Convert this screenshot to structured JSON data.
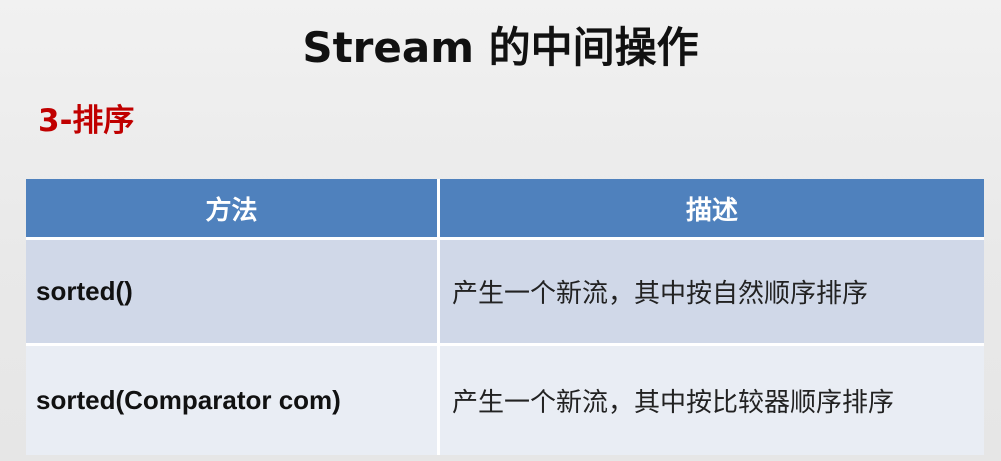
{
  "slide": {
    "title": "Stream 的中间操作",
    "subtitle": "3-排序"
  },
  "table": {
    "headers": [
      "方法",
      "描述"
    ],
    "rows": [
      [
        "sorted()",
        "产生一个新流，其中按自然顺序排序"
      ],
      [
        "sorted(Comparator com)",
        "产生一个新流，其中按比较器顺序排序"
      ]
    ]
  },
  "colors": {
    "header_bg": "#4f81bd",
    "row1_bg": "#d0d8e8",
    "row2_bg": "#e9edf4",
    "subtitle": "#c00000"
  }
}
